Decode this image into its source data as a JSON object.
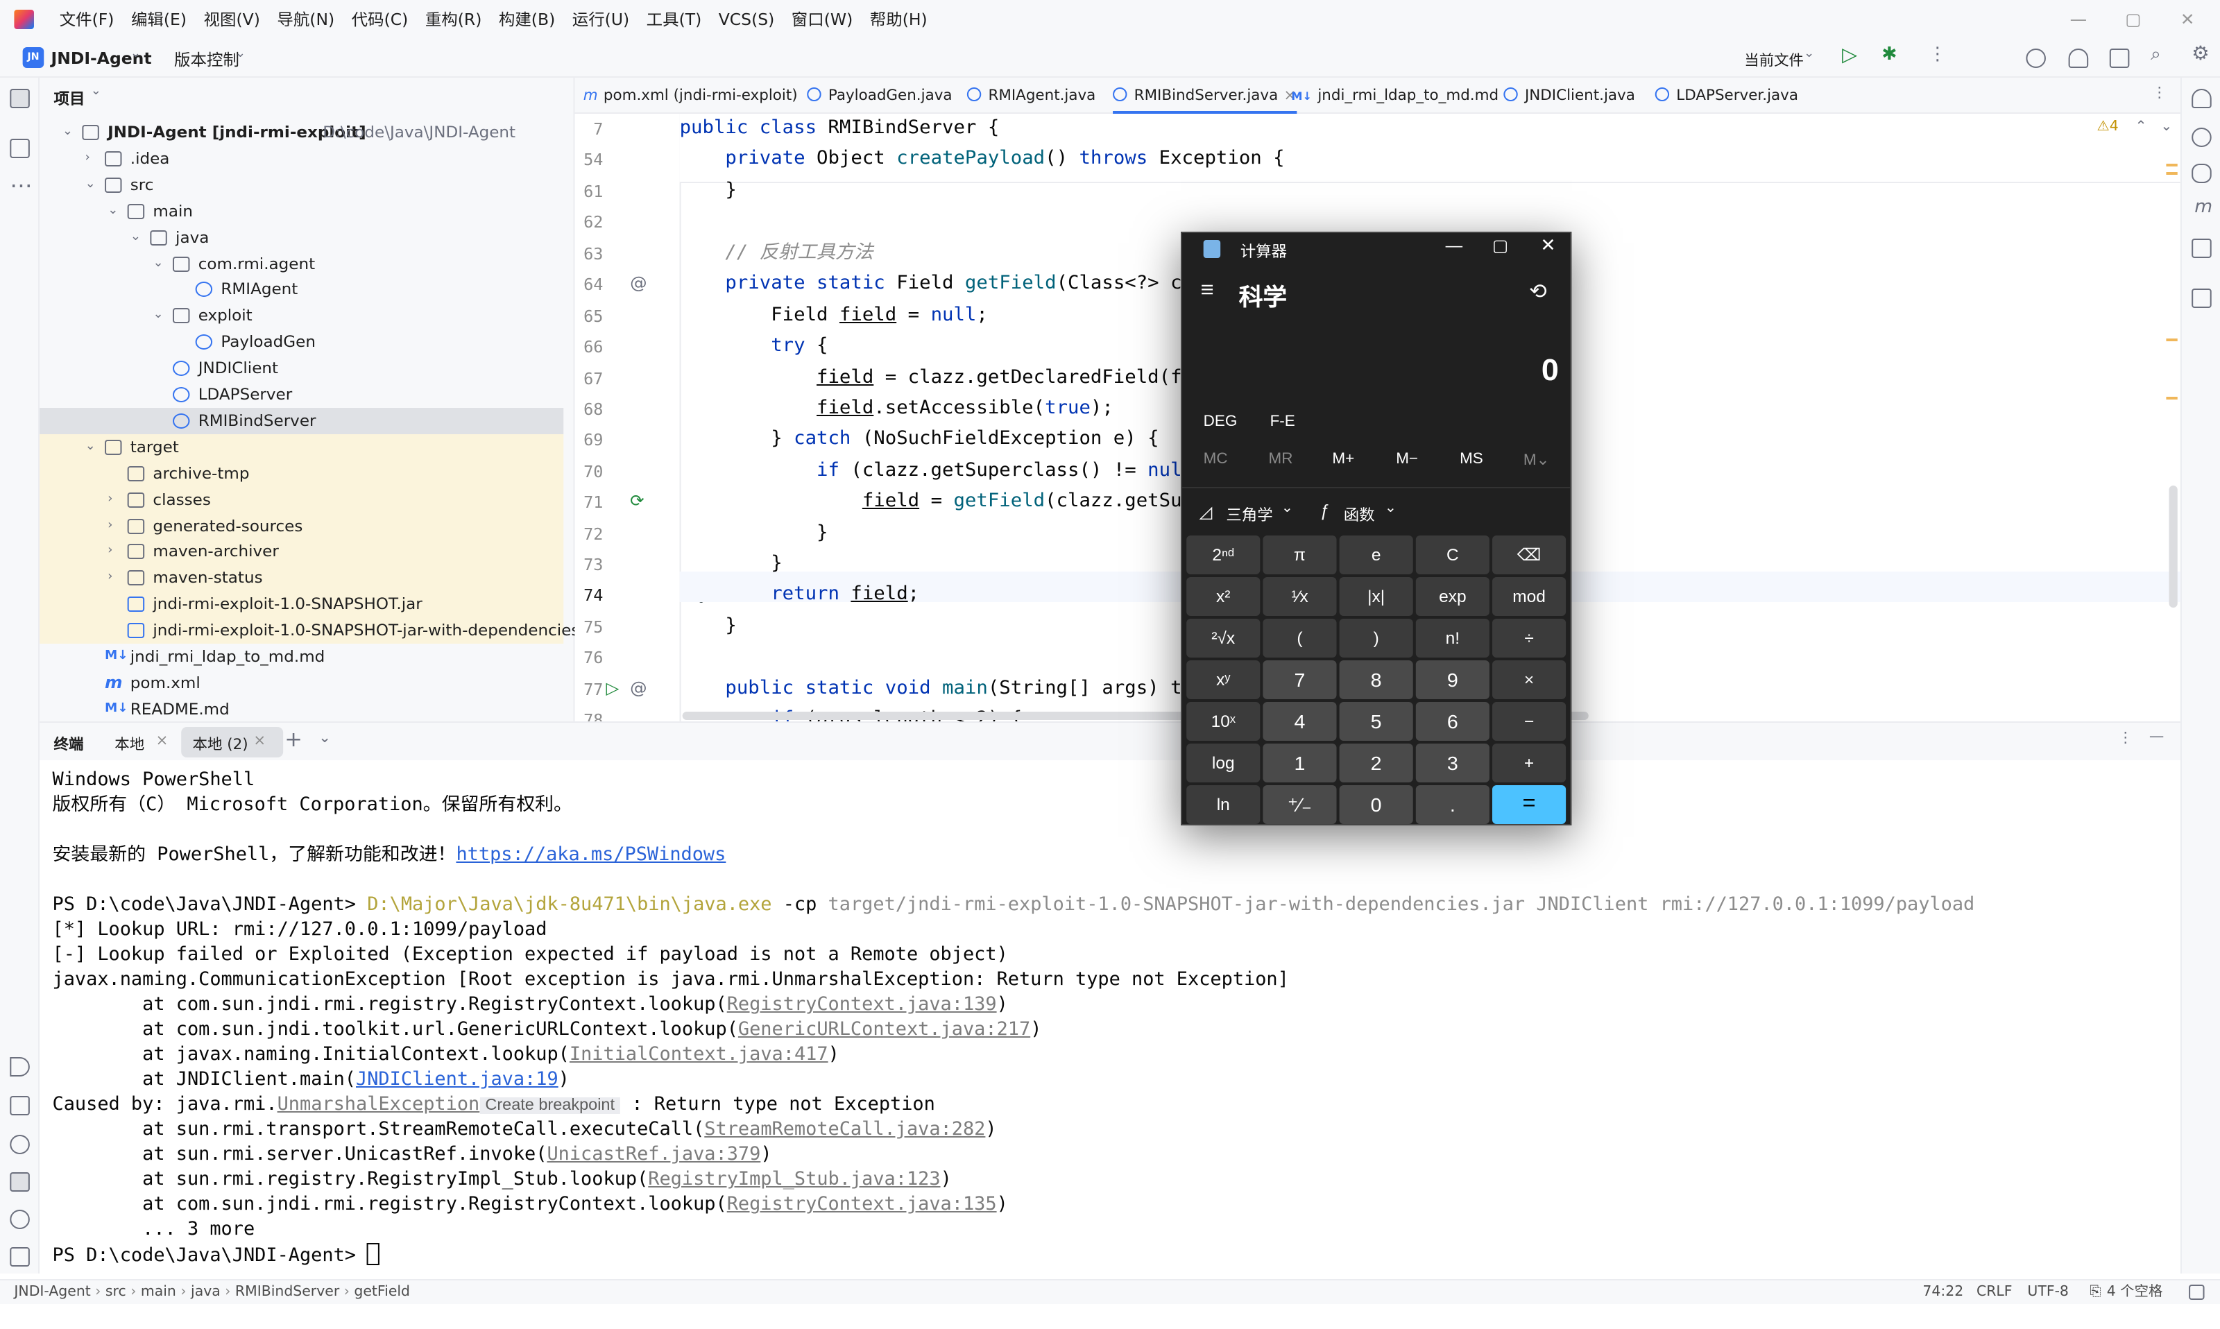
{
  "menu": [
    "文件(F)",
    "编辑(E)",
    "视图(V)",
    "导航(N)",
    "代码(C)",
    "重构(R)",
    "构建(B)",
    "运行(U)",
    "工具(T)",
    "VCS(S)",
    "窗口(W)",
    "帮助(H)"
  ],
  "toolbar": {
    "project_badge": "JN",
    "project": "JNDI-Agent",
    "vcs": "版本控制",
    "run_config": "当前文件"
  },
  "project_panel": {
    "title": "项目",
    "items": [
      {
        "label": "JNDI-Agent [jndi-rmi-exploit]",
        "extra": "D:\\code\\Java\\JNDI-Agent"
      },
      {
        "label": ".idea"
      },
      {
        "label": "src"
      },
      {
        "label": "main"
      },
      {
        "label": "java"
      },
      {
        "label": "com.rmi.agent"
      },
      {
        "label": "RMIAgent"
      },
      {
        "label": "exploit"
      },
      {
        "label": "PayloadGen"
      },
      {
        "label": "JNDIClient"
      },
      {
        "label": "LDAPServer"
      },
      {
        "label": "RMIBindServer"
      },
      {
        "label": "target"
      },
      {
        "label": "archive-tmp"
      },
      {
        "label": "classes"
      },
      {
        "label": "generated-sources"
      },
      {
        "label": "maven-archiver"
      },
      {
        "label": "maven-status"
      },
      {
        "label": "jndi-rmi-exploit-1.0-SNAPSHOT.jar"
      },
      {
        "label": "jndi-rmi-exploit-1.0-SNAPSHOT-jar-with-dependencies.jar"
      },
      {
        "label": "jndi_rmi_ldap_to_md.md"
      },
      {
        "label": "pom.xml"
      },
      {
        "label": "README.md"
      }
    ]
  },
  "tabs": [
    "pom.xml (jndi-rmi-exploit)",
    "PayloadGen.java",
    "RMIAgent.java",
    "RMIBindServer.java",
    "jndi_rmi_ldap_to_md.md",
    "JNDIClient.java",
    "LDAPServer.java"
  ],
  "editor": {
    "warnings": "⚠4",
    "line_numbers": [
      "7",
      "54",
      "61",
      "62",
      "63",
      "64",
      "65",
      "66",
      "67",
      "68",
      "69",
      "70",
      "71",
      "72",
      "73",
      "74",
      "75",
      "76",
      "77",
      "78"
    ],
    "lines": [
      "public class RMIBindServer {",
      "    private Object createPayload() throws Exception {",
      "    }",
      "",
      "    // 反射工具方法",
      "    private static Field getField(Class<?> cl",
      "        Field field = null;",
      "        try {",
      "            field = clazz.getDeclaredField(fi",
      "            field.setAccessible(true);",
      "        } catch (NoSuchFieldException e) {",
      "            if (clazz.getSuperclass() != null",
      "                field = getField(clazz.getSup",
      "            }",
      "        }",
      "        return field;",
      "    }",
      "",
      "    public static void main(String[] args) th",
      "        if (args.length < 2) {"
    ]
  },
  "terminal": {
    "title": "终端",
    "tabs": [
      "本地",
      "本地 (2)"
    ],
    "lines": [
      "Windows PowerShell",
      "版权所有（C） Microsoft Corporation。保留所有权利。",
      "",
      "安装最新的 PowerShell，了解新功能和改进！",
      "",
      "PS D:\\code\\Java\\JNDI-Agent> ",
      "[*] Lookup URL: rmi://127.0.0.1:1099/payload",
      "[-] Lookup failed or Exploited (Exception expected if payload is not a Remote object)",
      "javax.naming.CommunicationException [Root exception is java.rmi.UnmarshalException: Return type not Exception]",
      "        at com.sun.jndi.rmi.registry.RegistryContext.lookup(",
      "        at com.sun.jndi.toolkit.url.GenericURLContext.lookup(",
      "        at javax.naming.InitialContext.lookup(",
      "        at JNDIClient.main(",
      "Caused by: java.rmi.",
      "        at sun.rmi.transport.StreamRemoteCall.executeCall(",
      "        at sun.rmi.server.UnicastRef.invoke(",
      "        at sun.rmi.registry.RegistryImpl_Stub.lookup(",
      "        at com.sun.jndi.rmi.registry.RegistryContext.lookup(",
      "        ... 3 more",
      "PS D:\\code\\Java\\JNDI-Agent> "
    ],
    "link_pswindows": "https://aka.ms/PSWindows",
    "cmd_java": "D:\\Major\\Java\\jdk-8u471\\bin\\java.exe",
    "cmd_cp": " -cp ",
    "cmd_args": "target/jndi-rmi-exploit-1.0-SNAPSHOT-jar-with-dependencies.jar JNDIClient rmi://127.0.0.1:1099/payload",
    "refs": [
      "RegistryContext.java:139",
      "GenericURLContext.java:217",
      "InitialContext.java:417",
      "JNDIClient.java:19",
      "StreamRemoteCall.java:282",
      "UnicastRef.java:379",
      "RegistryImpl_Stub.java:123",
      "RegistryContext.java:135"
    ],
    "closeparen": ")",
    "unmarshal": "UnmarshalException",
    "create_bp": "Create breakpoint",
    "unmarshal_tail": " : Return type not Exception"
  },
  "statusbar": {
    "crumbs": [
      "JNDI-Agent",
      "src",
      "main",
      "java",
      "RMIBindServer",
      "getField"
    ],
    "position": "74:22",
    "line_sep": "CRLF",
    "encoding": "UTF-8",
    "indent": "4 个空格"
  },
  "calculator": {
    "title": "计算器",
    "mode": "科学",
    "display": "0",
    "angle": "DEG",
    "fe": "F-E",
    "memory": [
      "MC",
      "MR",
      "M+",
      "M−",
      "MS",
      "M⌄"
    ],
    "trig": "三角学",
    "func": "函数",
    "keys": [
      [
        "2ⁿᵈ",
        "π",
        "e",
        "C",
        "⌫"
      ],
      [
        "x²",
        "¹⁄x",
        "|x|",
        "exp",
        "mod"
      ],
      [
        "²√x",
        "(",
        ")",
        "n!",
        "÷"
      ],
      [
        "xʸ",
        "7",
        "8",
        "9",
        "×"
      ],
      [
        "10ˣ",
        "4",
        "5",
        "6",
        "−"
      ],
      [
        "log",
        "1",
        "2",
        "3",
        "+"
      ],
      [
        "ln",
        "⁺∕₋",
        "0",
        ".",
        "="
      ]
    ]
  },
  "colors": {
    "accent": "#3574f0",
    "calc_equals": "#4cc2ff",
    "keyword": "#0033b3",
    "method": "#00627a"
  }
}
